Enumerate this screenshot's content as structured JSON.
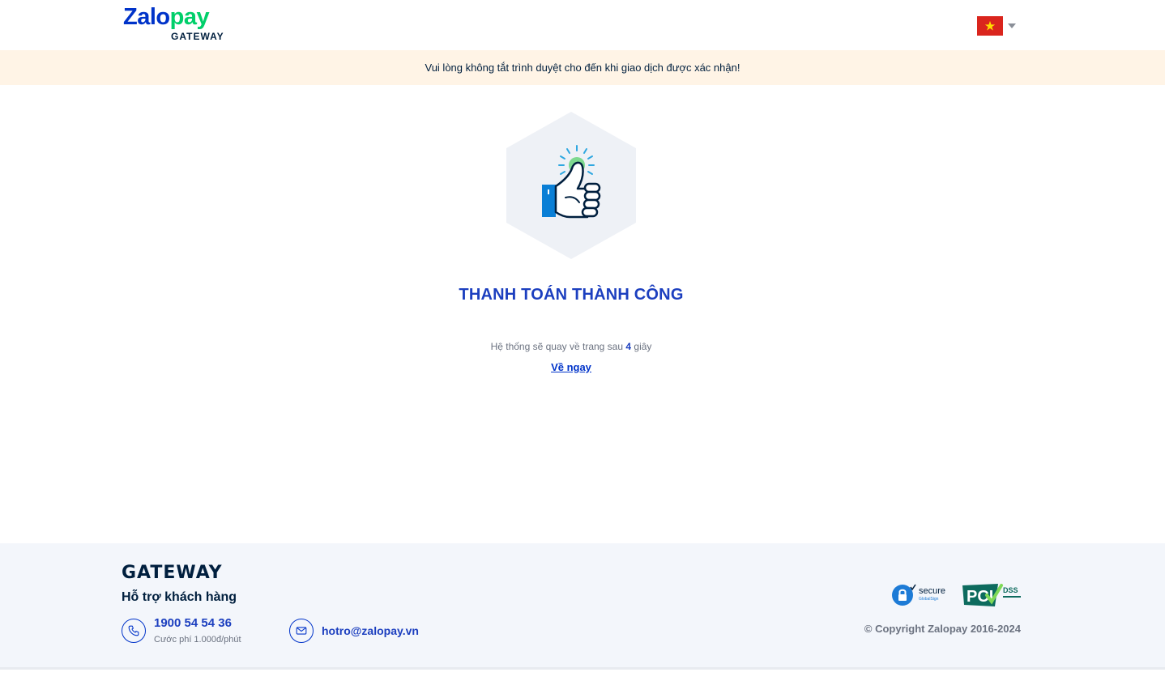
{
  "header": {
    "logo_zalo": "Zalo",
    "logo_pay": "pay",
    "logo_gateway": "GATEWAY",
    "language": "Vietnamese",
    "flag_icon": "vietnam-flag-icon",
    "dropdown_icon": "caret-down-icon"
  },
  "banner": {
    "text": "Vui lòng không tắt trình duyệt cho đến khi giao dịch được xác nhận!"
  },
  "main": {
    "illustration_icon": "thumbs-up-icon",
    "title": "THANH TOÁN THÀNH CÔNG",
    "redirect_prefix": "Hệ thống sẽ quay về trang sau",
    "redirect_seconds": "4",
    "redirect_suffix": "giây",
    "back_link": "Về ngay"
  },
  "footer": {
    "gateway_label": "GATEWAY",
    "support_title": "Hỗ trợ khách hàng",
    "phone_icon": "phone-icon",
    "phone_number": "1900 54 54 36",
    "phone_fee": "Cước phí 1.000đ/phút",
    "mail_icon": "mail-icon",
    "email": "hotro@zalopay.vn",
    "secure_badge_text": "secure",
    "secure_badge_sub": "GlobalSign",
    "pci_badge_text": "PCI",
    "pci_badge_dss": "DSS",
    "copyright": "© Copyright Zalopay 2016-2024"
  },
  "colors": {
    "brand_blue": "#0033c9",
    "brand_green": "#00cf6a",
    "title_blue": "#1c3fbf",
    "banner_bg": "#fff4e6",
    "footer_bg": "#f3f6fb"
  }
}
